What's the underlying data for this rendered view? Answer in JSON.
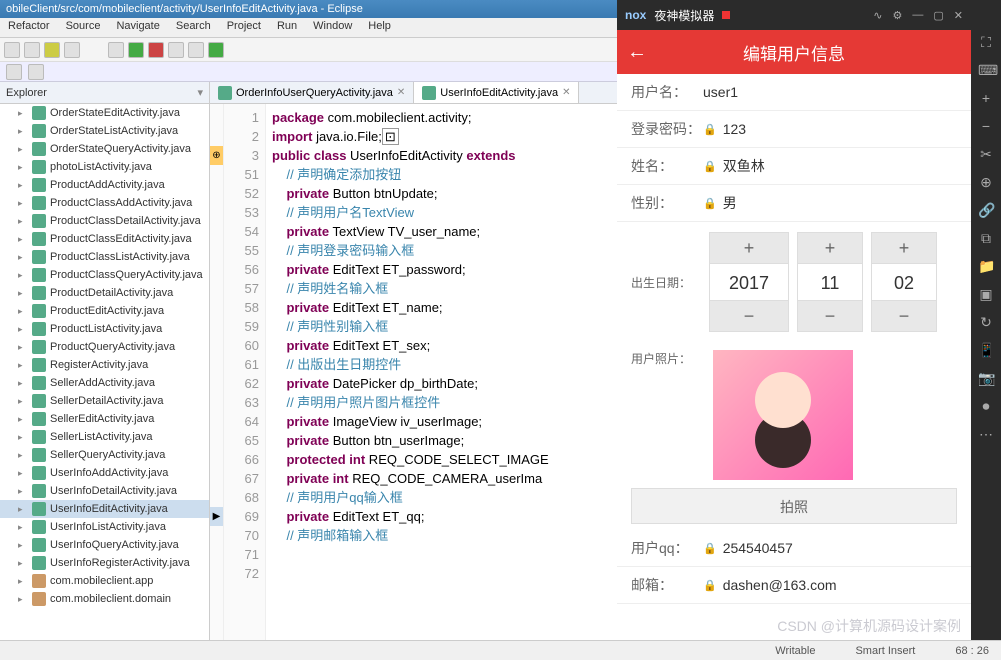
{
  "eclipse": {
    "title": "obileClient/src/com/mobileclient/activity/UserInfoEditActivity.java - Eclipse",
    "menu": [
      "Refactor",
      "Source",
      "Navigate",
      "Search",
      "Project",
      "Run",
      "Window",
      "Help"
    ],
    "explorer_title": "Explorer",
    "files": [
      "OrderStateEditActivity.java",
      "OrderStateListActivity.java",
      "OrderStateQueryActivity.java",
      "photoListActivity.java",
      "ProductAddActivity.java",
      "ProductClassAddActivity.java",
      "ProductClassDetailActivity.java",
      "ProductClassEditActivity.java",
      "ProductClassListActivity.java",
      "ProductClassQueryActivity.java",
      "ProductDetailActivity.java",
      "ProductEditActivity.java",
      "ProductListActivity.java",
      "ProductQueryActivity.java",
      "RegisterActivity.java",
      "SellerAddActivity.java",
      "SellerDetailActivity.java",
      "SellerEditActivity.java",
      "SellerListActivity.java",
      "SellerQueryActivity.java",
      "UserInfoAddActivity.java",
      "UserInfoDetailActivity.java",
      "UserInfoEditActivity.java",
      "UserInfoListActivity.java",
      "UserInfoQueryActivity.java",
      "UserInfoRegisterActivity.java"
    ],
    "packages": [
      "com.mobileclient.app",
      "com.mobileclient.domain"
    ],
    "selected_file_index": 22,
    "tabs": [
      {
        "label": "OrderInfoUserQueryActivity.java",
        "active": false
      },
      {
        "label": "UserInfoEditActivity.java",
        "active": true
      }
    ],
    "line_numbers": [
      "1",
      "2",
      "3",
      "",
      "51",
      "52",
      "53",
      "54",
      "55",
      "56",
      "57",
      "58",
      "59",
      "60",
      "61",
      "62",
      "63",
      "64",
      "65",
      "66",
      "67",
      "68",
      "69",
      "70",
      "71",
      "72"
    ],
    "code": {
      "l1": {
        "kw": "package",
        "rest": " com.mobileclient.activity;"
      },
      "l3": {
        "kw": "import",
        "rest": " java.io.File;"
      },
      "l51": {
        "kw": "public class",
        "mid": " UserInfoEditActivity ",
        "kw2": "extends"
      },
      "l52": "    // 声明确定添加按钮",
      "l53": {
        "kw": "private",
        "rest": " Button btnUpdate;"
      },
      "l54": "    // 声明用户名TextView",
      "l55": {
        "kw": "private",
        "rest": " TextView TV_user_name;"
      },
      "l56": "    // 声明登录密码输入框",
      "l57": {
        "kw": "private",
        "rest": " EditText ET_password;"
      },
      "l58": "    // 声明姓名输入框",
      "l59": {
        "kw": "private",
        "rest": " EditText ET_name;"
      },
      "l60": "    // 声明性别输入框",
      "l61": {
        "kw": "private",
        "rest": " EditText ET_sex;"
      },
      "l62": "    // 出版出生日期控件",
      "l63": {
        "kw": "private",
        "rest": " DatePicker dp_birthDate;"
      },
      "l64": "    // 声明用户照片图片框控件",
      "l65": {
        "kw": "private",
        "rest": " ImageView iv_userImage;"
      },
      "l66": {
        "kw": "private",
        "rest": " Button btn_userImage;"
      },
      "l67": {
        "kw": "protected int",
        "rest": " REQ_CODE_SELECT_IMAGE"
      },
      "l68": {
        "kw": "private int",
        "rest": " REQ_CODE_CAMERA_userIma"
      },
      "l69": "    // 声明用户qq输入框",
      "l70": {
        "kw": "private",
        "rest": " EditText ET_qq;"
      },
      "l71": "    // 声明邮箱输入框"
    },
    "status": {
      "writable": "Writable",
      "insert": "Smart Insert",
      "pos": "68 : 26"
    }
  },
  "emulator": {
    "title": "夜神模拟器",
    "logo": "nox",
    "app_title": "编辑用户信息",
    "form": {
      "username_label": "用户名：",
      "username_value": "user1",
      "password_label": "登录密码：",
      "password_value": "123",
      "name_label": "姓名：",
      "name_value": "双鱼林",
      "gender_label": "性别：",
      "gender_value": "男",
      "birth_label": "出生日期：",
      "birth_year": "2017",
      "birth_month": "11",
      "birth_day": "02",
      "photo_label": "用户照片：",
      "take_photo": "拍照",
      "qq_label": "用户qq：",
      "qq_value": "254540457",
      "email_label": "邮箱：",
      "email_value": "dashen@163.com"
    }
  },
  "watermark": "CSDN @计算机源码设计案例"
}
